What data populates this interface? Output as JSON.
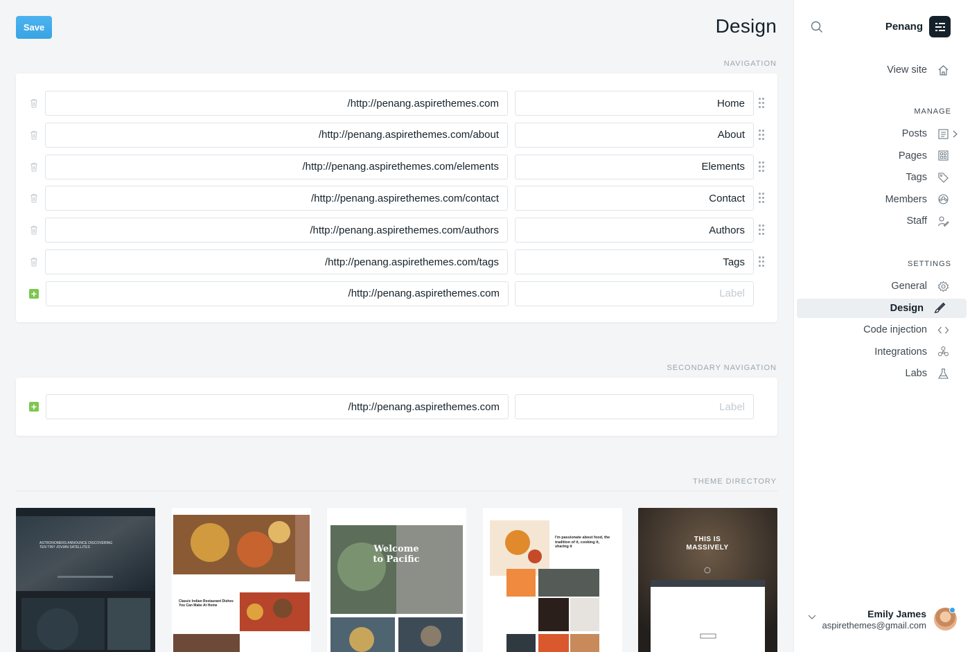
{
  "toolbar": {
    "save_label": "Save"
  },
  "page": {
    "title": "Design"
  },
  "navigation": {
    "heading": "Navigation",
    "items": [
      {
        "url": "/http://penang.aspirethemes.com",
        "label": "Home"
      },
      {
        "url": "/http://penang.aspirethemes.com/about",
        "label": "About"
      },
      {
        "url": "/http://penang.aspirethemes.com/elements",
        "label": "Elements"
      },
      {
        "url": "/http://penang.aspirethemes.com/contact",
        "label": "Contact"
      },
      {
        "url": "/http://penang.aspirethemes.com/authors",
        "label": "Authors"
      },
      {
        "url": "/http://penang.aspirethemes.com/tags",
        "label": "Tags"
      }
    ],
    "new_item": {
      "url": "/http://penang.aspirethemes.com",
      "label_placeholder": "Label"
    }
  },
  "secondary_navigation": {
    "heading": "Secondary Navigation",
    "new_item": {
      "url": "/http://penang.aspirethemes.com",
      "label_placeholder": "Label"
    }
  },
  "theme_directory": {
    "heading": "Theme Directory",
    "themes": [
      {
        "icon": "theme-thumbnail-dark",
        "text": "ASTRONOMERS ANNOUNCE DISCOVERING TEN TINY JOVIAN SATELLITES"
      },
      {
        "icon": "theme-thumbnail-food",
        "text": "Classic Indian Restaurant Dishes You Can Make At Home"
      },
      {
        "icon": "theme-thumbnail-pacific",
        "text": "Welcome to Pacific"
      },
      {
        "icon": "theme-thumbnail-recipes",
        "text": "I'm passionate about food, the tradition of it, cooking it, sharing it"
      },
      {
        "icon": "theme-thumbnail-massively",
        "text": "THIS IS MASSIVELY"
      }
    ]
  },
  "sidebar": {
    "site_title": "Penang",
    "view_site": "View site",
    "manage_heading": "Manage",
    "manage_items": [
      {
        "label": "Posts",
        "icon": "posts-icon"
      },
      {
        "label": "Pages",
        "icon": "pages-icon"
      },
      {
        "label": "Tags",
        "icon": "tag-icon"
      },
      {
        "label": "Members",
        "icon": "members-icon"
      },
      {
        "label": "Staff",
        "icon": "staff-icon"
      }
    ],
    "settings_heading": "Settings",
    "settings_items": [
      {
        "label": "General",
        "icon": "gear-icon"
      },
      {
        "label": "Design",
        "icon": "brush-icon",
        "active": true
      },
      {
        "label": "Code injection",
        "icon": "code-icon"
      },
      {
        "label": "Integrations",
        "icon": "integrations-icon"
      },
      {
        "label": "Labs",
        "icon": "flask-icon"
      }
    ],
    "user": {
      "name": "Emily James",
      "email": "aspirethemes@gmail.com"
    }
  },
  "colors": {
    "accent": "#3aa3e3",
    "add": "#7ec74f",
    "dark": "#15212a"
  }
}
